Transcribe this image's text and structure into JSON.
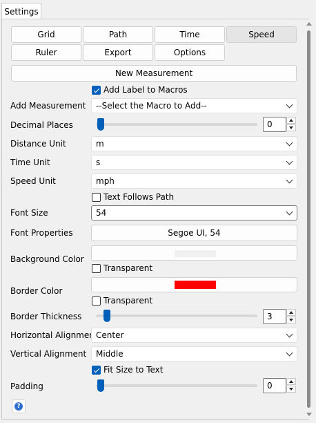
{
  "tab": {
    "label": "Settings"
  },
  "nav_buttons": {
    "row1": [
      "Grid",
      "Path",
      "Time",
      "Speed"
    ],
    "row2": [
      "Ruler",
      "Export",
      "Options"
    ],
    "selected": "Speed"
  },
  "new_measurement_label": "New Measurement",
  "add_label_to_macros": {
    "label": "Add Label to Macros",
    "checked": true
  },
  "add_measurement": {
    "label": "Add Measurement",
    "value": "--Select the Macro to Add--"
  },
  "decimal_places": {
    "label": "Decimal Places",
    "value": "0",
    "slider_fraction": 0.0
  },
  "distance_unit": {
    "label": "Distance Unit",
    "value": "m"
  },
  "time_unit": {
    "label": "Time Unit",
    "value": "s"
  },
  "speed_unit": {
    "label": "Speed Unit",
    "value": "mph"
  },
  "text_follows_path": {
    "label": "Text Follows Path",
    "checked": false
  },
  "font_size": {
    "label": "Font Size",
    "value": "54"
  },
  "font_properties": {
    "label": "Font Properties",
    "value": "Segoe UI, 54"
  },
  "background_color": {
    "label": "Background Color",
    "swatch": "#f0f0f0",
    "transparent_label": "Transparent",
    "transparent_checked": false
  },
  "border_color": {
    "label": "Border Color",
    "swatch": "#ff0000",
    "transparent_label": "Transparent",
    "transparent_checked": false
  },
  "border_thickness": {
    "label": "Border Thickness",
    "value": "3",
    "slider_fraction": 0.06
  },
  "horizontal_alignment": {
    "label": "Horizontal Alignment",
    "value": "Center"
  },
  "vertical_alignment": {
    "label": "Vertical Alignment",
    "value": "Middle"
  },
  "fit_size_to_text": {
    "label": "Fit Size to Text",
    "checked": true
  },
  "padding": {
    "label": "Padding",
    "value": "0",
    "slider_fraction": 0.0
  },
  "help": {
    "icon": "help-icon",
    "glyph": "?"
  },
  "colors": {
    "accent": "#005fb8",
    "selected_tab": "#e5e5e5"
  }
}
